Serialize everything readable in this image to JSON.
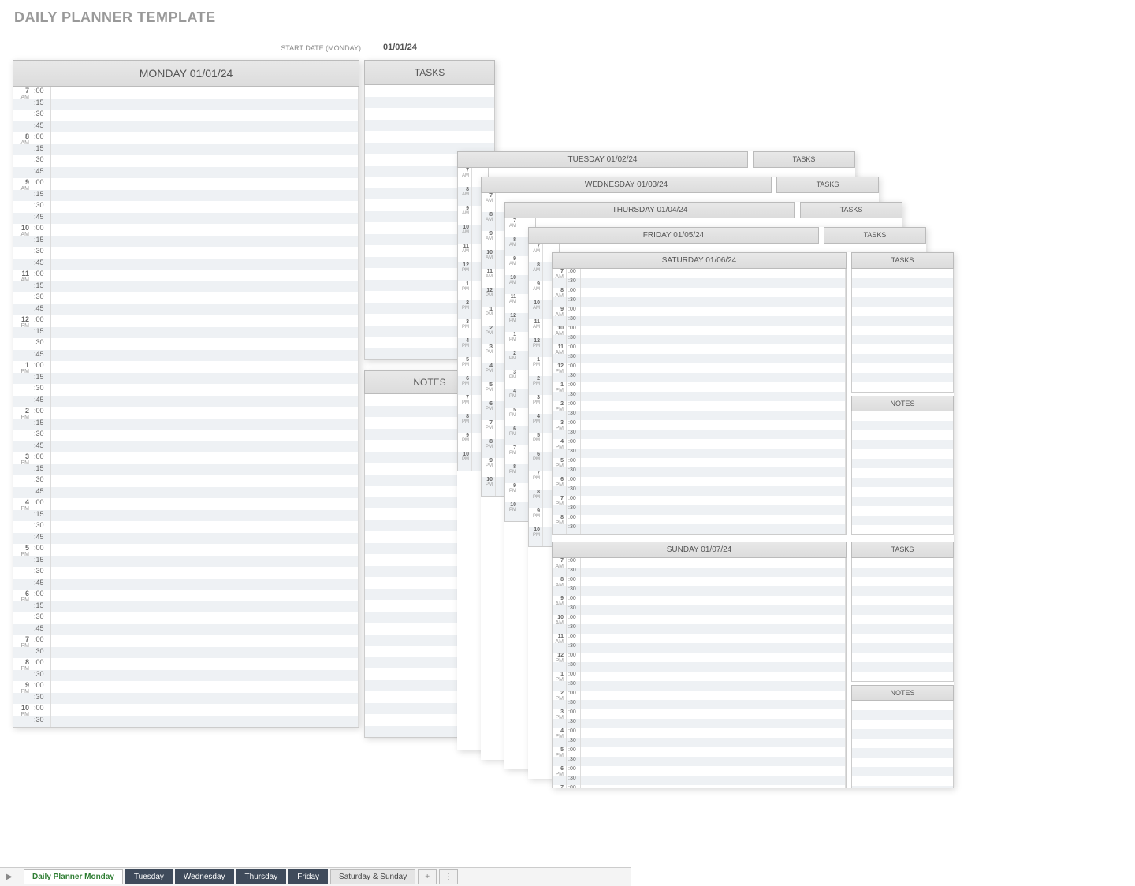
{
  "title": "DAILY PLANNER TEMPLATE",
  "start_date_label": "START DATE (MONDAY)",
  "start_date_value": "01/01/24",
  "labels": {
    "tasks": "TASKS",
    "notes": "NOTES"
  },
  "days": {
    "monday": "MONDAY 01/01/24",
    "tuesday": "TUESDAY 01/02/24",
    "wednesday": "WEDNESDAY 01/03/24",
    "thursday": "THURSDAY 01/04/24",
    "friday": "FRIDAY 01/05/24",
    "saturday": "SATURDAY 01/06/24",
    "sunday": "SUNDAY 01/07/24"
  },
  "monday_slots": [
    {
      "hour": "7",
      "ampm": "AM",
      "min": ":00"
    },
    {
      "hour": "",
      "ampm": "",
      "min": ":15"
    },
    {
      "hour": "",
      "ampm": "",
      "min": ":30"
    },
    {
      "hour": "",
      "ampm": "",
      "min": ":45"
    },
    {
      "hour": "8",
      "ampm": "AM",
      "min": ":00"
    },
    {
      "hour": "",
      "ampm": "",
      "min": ":15"
    },
    {
      "hour": "",
      "ampm": "",
      "min": ":30"
    },
    {
      "hour": "",
      "ampm": "",
      "min": ":45"
    },
    {
      "hour": "9",
      "ampm": "AM",
      "min": ":00"
    },
    {
      "hour": "",
      "ampm": "",
      "min": ":15"
    },
    {
      "hour": "",
      "ampm": "",
      "min": ":30"
    },
    {
      "hour": "",
      "ampm": "",
      "min": ":45"
    },
    {
      "hour": "10",
      "ampm": "AM",
      "min": ":00"
    },
    {
      "hour": "",
      "ampm": "",
      "min": ":15"
    },
    {
      "hour": "",
      "ampm": "",
      "min": ":30"
    },
    {
      "hour": "",
      "ampm": "",
      "min": ":45"
    },
    {
      "hour": "11",
      "ampm": "AM",
      "min": ":00"
    },
    {
      "hour": "",
      "ampm": "",
      "min": ":15"
    },
    {
      "hour": "",
      "ampm": "",
      "min": ":30"
    },
    {
      "hour": "",
      "ampm": "",
      "min": ":45"
    },
    {
      "hour": "12",
      "ampm": "PM",
      "min": ":00"
    },
    {
      "hour": "",
      "ampm": "",
      "min": ":15"
    },
    {
      "hour": "",
      "ampm": "",
      "min": ":30"
    },
    {
      "hour": "",
      "ampm": "",
      "min": ":45"
    },
    {
      "hour": "1",
      "ampm": "PM",
      "min": ":00"
    },
    {
      "hour": "",
      "ampm": "",
      "min": ":15"
    },
    {
      "hour": "",
      "ampm": "",
      "min": ":30"
    },
    {
      "hour": "",
      "ampm": "",
      "min": ":45"
    },
    {
      "hour": "2",
      "ampm": "PM",
      "min": ":00"
    },
    {
      "hour": "",
      "ampm": "",
      "min": ":15"
    },
    {
      "hour": "",
      "ampm": "",
      "min": ":30"
    },
    {
      "hour": "",
      "ampm": "",
      "min": ":45"
    },
    {
      "hour": "3",
      "ampm": "PM",
      "min": ":00"
    },
    {
      "hour": "",
      "ampm": "",
      "min": ":15"
    },
    {
      "hour": "",
      "ampm": "",
      "min": ":30"
    },
    {
      "hour": "",
      "ampm": "",
      "min": ":45"
    },
    {
      "hour": "4",
      "ampm": "PM",
      "min": ":00"
    },
    {
      "hour": "",
      "ampm": "",
      "min": ":15"
    },
    {
      "hour": "",
      "ampm": "",
      "min": ":30"
    },
    {
      "hour": "",
      "ampm": "",
      "min": ":45"
    },
    {
      "hour": "5",
      "ampm": "PM",
      "min": ":00"
    },
    {
      "hour": "",
      "ampm": "",
      "min": ":15"
    },
    {
      "hour": "",
      "ampm": "",
      "min": ":30"
    },
    {
      "hour": "",
      "ampm": "",
      "min": ":45"
    },
    {
      "hour": "6",
      "ampm": "PM",
      "min": ":00"
    },
    {
      "hour": "",
      "ampm": "",
      "min": ":15"
    },
    {
      "hour": "",
      "ampm": "",
      "min": ":30"
    },
    {
      "hour": "",
      "ampm": "",
      "min": ":45"
    },
    {
      "hour": "7",
      "ampm": "PM",
      "min": ":00"
    },
    {
      "hour": "",
      "ampm": "",
      "min": ":30"
    },
    {
      "hour": "8",
      "ampm": "PM",
      "min": ":00"
    },
    {
      "hour": "",
      "ampm": "",
      "min": ":30"
    },
    {
      "hour": "9",
      "ampm": "PM",
      "min": ":00"
    },
    {
      "hour": "",
      "ampm": "",
      "min": ":30"
    },
    {
      "hour": "10",
      "ampm": "PM",
      "min": ":00"
    },
    {
      "hour": "",
      "ampm": "",
      "min": ":30"
    }
  ],
  "weekend_slots": [
    {
      "hour": "7",
      "ampm": "AM",
      "min": ":00"
    },
    {
      "hour": "",
      "ampm": "",
      "min": ":30"
    },
    {
      "hour": "8",
      "ampm": "AM",
      "min": ":00"
    },
    {
      "hour": "",
      "ampm": "",
      "min": ":30"
    },
    {
      "hour": "9",
      "ampm": "AM",
      "min": ":00"
    },
    {
      "hour": "",
      "ampm": "",
      "min": ":30"
    },
    {
      "hour": "10",
      "ampm": "AM",
      "min": ":00"
    },
    {
      "hour": "",
      "ampm": "",
      "min": ":30"
    },
    {
      "hour": "11",
      "ampm": "AM",
      "min": ":00"
    },
    {
      "hour": "",
      "ampm": "",
      "min": ":30"
    },
    {
      "hour": "12",
      "ampm": "PM",
      "min": ":00"
    },
    {
      "hour": "",
      "ampm": "",
      "min": ":30"
    },
    {
      "hour": "1",
      "ampm": "PM",
      "min": ":00"
    },
    {
      "hour": "",
      "ampm": "",
      "min": ":30"
    },
    {
      "hour": "2",
      "ampm": "PM",
      "min": ":00"
    },
    {
      "hour": "",
      "ampm": "",
      "min": ":30"
    },
    {
      "hour": "3",
      "ampm": "PM",
      "min": ":00"
    },
    {
      "hour": "",
      "ampm": "",
      "min": ":30"
    },
    {
      "hour": "4",
      "ampm": "PM",
      "min": ":00"
    },
    {
      "hour": "",
      "ampm": "",
      "min": ":30"
    },
    {
      "hour": "5",
      "ampm": "PM",
      "min": ":00"
    },
    {
      "hour": "",
      "ampm": "",
      "min": ":30"
    },
    {
      "hour": "6",
      "ampm": "PM",
      "min": ":00"
    },
    {
      "hour": "",
      "ampm": "",
      "min": ":30"
    },
    {
      "hour": "7",
      "ampm": "PM",
      "min": ":00"
    },
    {
      "hour": "",
      "ampm": "",
      "min": ":30"
    },
    {
      "hour": "8",
      "ampm": "PM",
      "min": ":00"
    },
    {
      "hour": "",
      "ampm": "",
      "min": ":30"
    }
  ],
  "tabs": [
    {
      "label": "Daily Planner Monday",
      "style": "active"
    },
    {
      "label": "Tuesday",
      "style": "dark"
    },
    {
      "label": "Wednesday",
      "style": "dark"
    },
    {
      "label": "Thursday",
      "style": "dark"
    },
    {
      "label": "Friday",
      "style": "dark"
    },
    {
      "label": "Saturday & Sunday",
      "style": "light"
    }
  ]
}
